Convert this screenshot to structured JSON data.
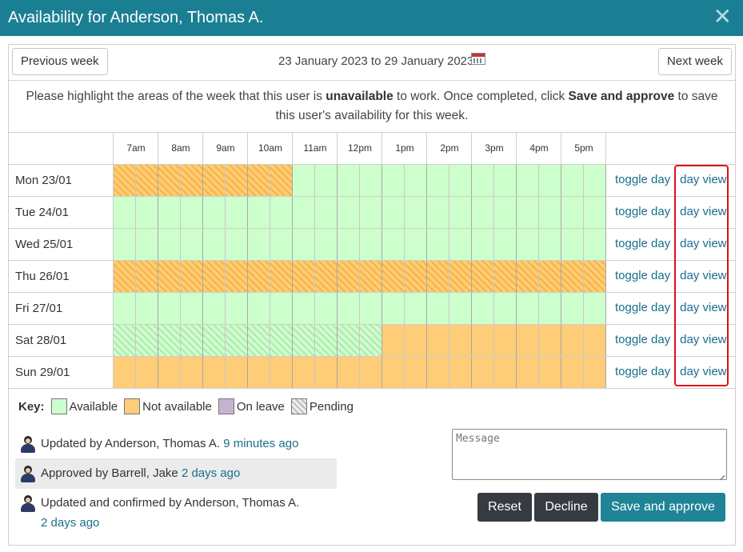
{
  "title": "Availability for Anderson, Thomas A.",
  "nav": {
    "prev_label": "Previous week",
    "next_label": "Next week",
    "date_range": "23 January 2023 to 29 January 2023"
  },
  "instructions": {
    "t1": "Please highlight the areas of the week that this user is ",
    "b1": "unavailable",
    "t2": " to work. Once completed, click ",
    "b2": "Save and approve",
    "t3": " to save this user's availability for this week."
  },
  "hours": [
    "7am",
    "8am",
    "9am",
    "10am",
    "11am",
    "12pm",
    "1pm",
    "2pm",
    "3pm",
    "4pm",
    "5pm"
  ],
  "slots_per_hour": 2,
  "days": [
    {
      "label": "Mon 23/01",
      "toggle": "toggle day",
      "view": "day view",
      "slots": "NNNNNNNNAAAAAAAAAAAAAA"
    },
    {
      "label": "Tue 24/01",
      "toggle": "toggle day",
      "view": "day view",
      "slots": "AAAAAAAAAAAAAAAAAAAAAA"
    },
    {
      "label": "Wed 25/01",
      "toggle": "toggle day",
      "view": "day view",
      "slots": "AAAAAAAAAAAAAAAAAAAAAA"
    },
    {
      "label": "Thu 26/01",
      "toggle": "toggle day",
      "view": "day view",
      "slots": "NNNNNNNNNNNNNNNNNNNNNN"
    },
    {
      "label": "Fri 27/01",
      "toggle": "toggle day",
      "view": "day view",
      "slots": "AAAAAAAAAAAAAAAAAAAAAA"
    },
    {
      "label": "Sat 28/01",
      "toggle": "toggle day",
      "view": "day view",
      "slots": "PPPPPPPPPPPPXXXXXXXXXX"
    },
    {
      "label": "Sun 29/01",
      "toggle": "toggle day",
      "view": "day view",
      "slots": "XXXXXXXXXXXXXXXXXXXXXX"
    }
  ],
  "slot_legend": {
    "A": "available",
    "N": "not available (pending change)",
    "X": "not available",
    "P": "available (pending change)"
  },
  "link_separator": "|",
  "key": {
    "title": "Key:",
    "items": [
      {
        "label": "Available",
        "type": "available"
      },
      {
        "label": "Not available",
        "type": "unavailable"
      },
      {
        "label": "On leave",
        "type": "leave"
      },
      {
        "label": "Pending",
        "type": "pending"
      }
    ]
  },
  "colors": {
    "available": "#ccffcc",
    "unavailable": "#ffcc77",
    "leave": "#c7b3d0",
    "pending_stripe": "#bbbbbb",
    "header": "#1b7f93",
    "link": "#1a6f8a",
    "highlight_box": "#e0101a"
  },
  "activity": [
    {
      "text": "Updated by Anderson, Thomas A.",
      "time": "9 minutes ago"
    },
    {
      "text": "Approved by Barrell, Jake",
      "time": "2 days ago"
    },
    {
      "text": "Updated and confirmed by Anderson, Thomas A.",
      "time": "2 days ago"
    }
  ],
  "message": {
    "placeholder": "Message",
    "value": ""
  },
  "buttons": {
    "reset": "Reset",
    "decline": "Decline",
    "save": "Save and approve"
  },
  "close_glyph": "✕"
}
